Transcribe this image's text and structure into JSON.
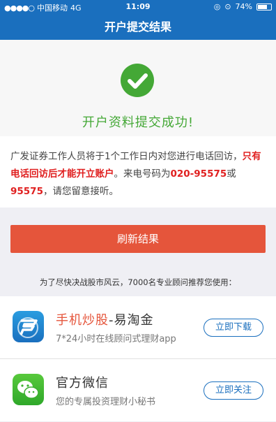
{
  "status_bar": {
    "signal": "●●●●○",
    "carrier": "中国移动",
    "network": "4G",
    "time": "11:09",
    "battery_percent": "74%",
    "battery_level": 0.74
  },
  "nav": {
    "title": "开户提交结果"
  },
  "result": {
    "icon": "check-circle-icon",
    "title": "开户资料提交成功!"
  },
  "notice": {
    "part1": "广发证券工作人员将于1个工作日内对您进行电话回访，",
    "highlight1": "只有电话回访后才能开立账户",
    "part2": "。来电号码为",
    "phone1": "020-95575",
    "part3": "或",
    "phone2": "95575",
    "part4": "，请您留意接听。"
  },
  "actions": {
    "refresh_label": "刷新结果",
    "recommend_text": "为了尽快决战股市风云，7000名专业顾问推荐您使用："
  },
  "apps": [
    {
      "title_highlight": "手机炒股",
      "title_rest": "-易淘金",
      "subtitle": "7*24小时在线顾问式理财app",
      "button": "立即下载",
      "icon": "yitaojin-app-icon"
    },
    {
      "title": "官方微信",
      "subtitle": "您的专属投资理财小秘书",
      "button": "立即关注",
      "icon": "wechat-icon"
    }
  ],
  "colors": {
    "brand_blue": "#1a6fbe",
    "success_green": "#44a836",
    "accent_red": "#e5553b",
    "highlight_red": "#e02020"
  }
}
